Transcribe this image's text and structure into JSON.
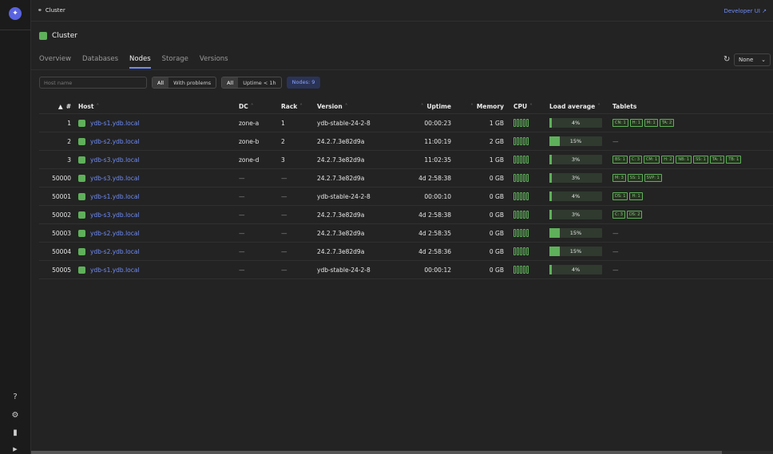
{
  "topbar": {
    "breadcrumb": "Cluster",
    "developer_ui": "Developer UI"
  },
  "cluster": {
    "title": "Cluster"
  },
  "tabs": [
    {
      "label": "Overview",
      "active": false
    },
    {
      "label": "Databases",
      "active": false
    },
    {
      "label": "Nodes",
      "active": true
    },
    {
      "label": "Storage",
      "active": false
    },
    {
      "label": "Versions",
      "active": false
    }
  ],
  "controls": {
    "refresh_select_value": "None"
  },
  "filters": {
    "host_placeholder": "Host name",
    "problems_all": "All",
    "problems_with": "With problems",
    "uptime_all": "All",
    "uptime_short": "Uptime < 1h",
    "nodes_count": "Nodes: 9"
  },
  "table": {
    "headers": {
      "id": "#",
      "host": "Host",
      "dc": "DC",
      "rack": "Rack",
      "version": "Version",
      "uptime": "Uptime",
      "memory": "Memory",
      "cpu": "CPU",
      "load_average": "Load average",
      "tablets": "Tablets"
    },
    "rows": [
      {
        "id": "1",
        "host": "ydb-s1.ydb.local",
        "dc": "zone-a",
        "rack": "1",
        "version": "ydb-stable-24-2-8",
        "uptime": "00:00:23",
        "memory": "1 GB",
        "load": "4%",
        "load_pct": 4,
        "tablets": [
          "CN: 1",
          "H: 1",
          "M: 1",
          "TA: 2"
        ]
      },
      {
        "id": "2",
        "host": "ydb-s2.ydb.local",
        "dc": "zone-b",
        "rack": "2",
        "version": "24.2.7.3e82d9a",
        "uptime": "11:00:19",
        "memory": "2 GB",
        "load": "15%",
        "load_pct": 15,
        "tablets": [
          "—"
        ]
      },
      {
        "id": "3",
        "host": "ydb-s3.ydb.local",
        "dc": "zone-d",
        "rack": "3",
        "version": "24.2.7.3e82d9a",
        "uptime": "11:02:35",
        "memory": "1 GB",
        "load": "3%",
        "load_pct": 3,
        "tablets": [
          "BS: 1",
          "C: 3",
          "CM: 1",
          "H: 2",
          "NB: 1",
          "SS: 1",
          "TA: 1",
          "TB: 1"
        ]
      },
      {
        "id": "50000",
        "host": "ydb-s3.ydb.local",
        "dc": "—",
        "rack": "—",
        "version": "24.2.7.3e82d9a",
        "uptime": "4d 2:58:38",
        "memory": "0 GB",
        "load": "3%",
        "load_pct": 3,
        "tablets": [
          "M: 3",
          "SS: 1",
          "SVP: 1"
        ]
      },
      {
        "id": "50001",
        "host": "ydb-s1.ydb.local",
        "dc": "—",
        "rack": "—",
        "version": "ydb-stable-24-2-8",
        "uptime": "00:00:10",
        "memory": "0 GB",
        "load": "4%",
        "load_pct": 4,
        "tablets": [
          "DS: 1",
          "H: 1"
        ]
      },
      {
        "id": "50002",
        "host": "ydb-s3.ydb.local",
        "dc": "—",
        "rack": "—",
        "version": "24.2.7.3e82d9a",
        "uptime": "4d 2:58:38",
        "memory": "0 GB",
        "load": "3%",
        "load_pct": 3,
        "tablets": [
          "C: 3",
          "DS: 2"
        ]
      },
      {
        "id": "50003",
        "host": "ydb-s2.ydb.local",
        "dc": "—",
        "rack": "—",
        "version": "24.2.7.3e82d9a",
        "uptime": "4d 2:58:35",
        "memory": "0 GB",
        "load": "15%",
        "load_pct": 15,
        "tablets": [
          "—"
        ]
      },
      {
        "id": "50004",
        "host": "ydb-s2.ydb.local",
        "dc": "—",
        "rack": "—",
        "version": "24.2.7.3e82d9a",
        "uptime": "4d 2:58:36",
        "memory": "0 GB",
        "load": "15%",
        "load_pct": 15,
        "tablets": [
          "—"
        ]
      },
      {
        "id": "50005",
        "host": "ydb-s1.ydb.local",
        "dc": "—",
        "rack": "—",
        "version": "ydb-stable-24-2-8",
        "uptime": "00:00:12",
        "memory": "0 GB",
        "load": "4%",
        "load_pct": 4,
        "tablets": [
          "—"
        ]
      }
    ]
  },
  "colors": {
    "accent": "#6f8cf7",
    "healthy": "#5fb05a",
    "background": "#232323"
  }
}
